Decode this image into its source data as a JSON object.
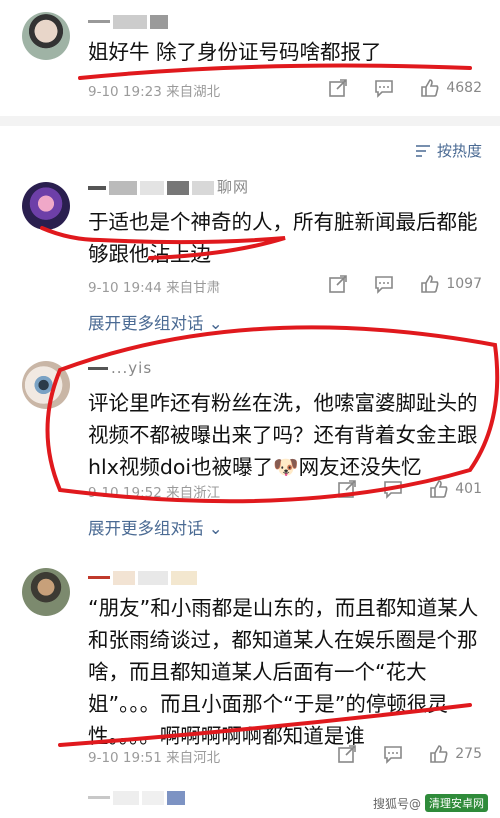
{
  "comments": [
    {
      "text": "姐好牛 除了身份证号码啥都报了",
      "meta": "9-10 19:23 来自湖北",
      "likes": "4682"
    },
    {
      "username": "聊网",
      "text": "于适也是个神奇的人，所有脏新闻最后都能够跟他沾上边",
      "meta": "9-10 19:44 来自甘肃",
      "likes": "1097",
      "expand": "展开更多组对话"
    },
    {
      "username": "...yis",
      "text": "评论里咋还有粉丝在洗，他嗦富婆脚趾头的视频不都被曝出来了吗？还有背着女金主跟hlx视频doi也被曝了🐶网友还没失忆",
      "meta": "9-10 19:52 来自浙江",
      "likes": "401",
      "expand": "展开更多组对话"
    },
    {
      "text": "“朋友”和小雨都是山东的，而且都知道某人和张雨绮谈过，都知道某人在娱乐圈是个那啥，而且都知道某人后面有一个“花大姐”。。。而且小面那个“于是”的停顿很灵性。。。。啊啊啊啊啊都知道是谁",
      "meta": "9-10 19:51 来自河北",
      "likes": "275"
    }
  ],
  "sort": {
    "label": "按热度"
  },
  "watermark": {
    "badge": "清理安卓网",
    "text": "搜狐号@"
  },
  "colors": {
    "accent": "#4a6a93",
    "meta": "#9b9b9b",
    "ink": "#e0191d"
  }
}
